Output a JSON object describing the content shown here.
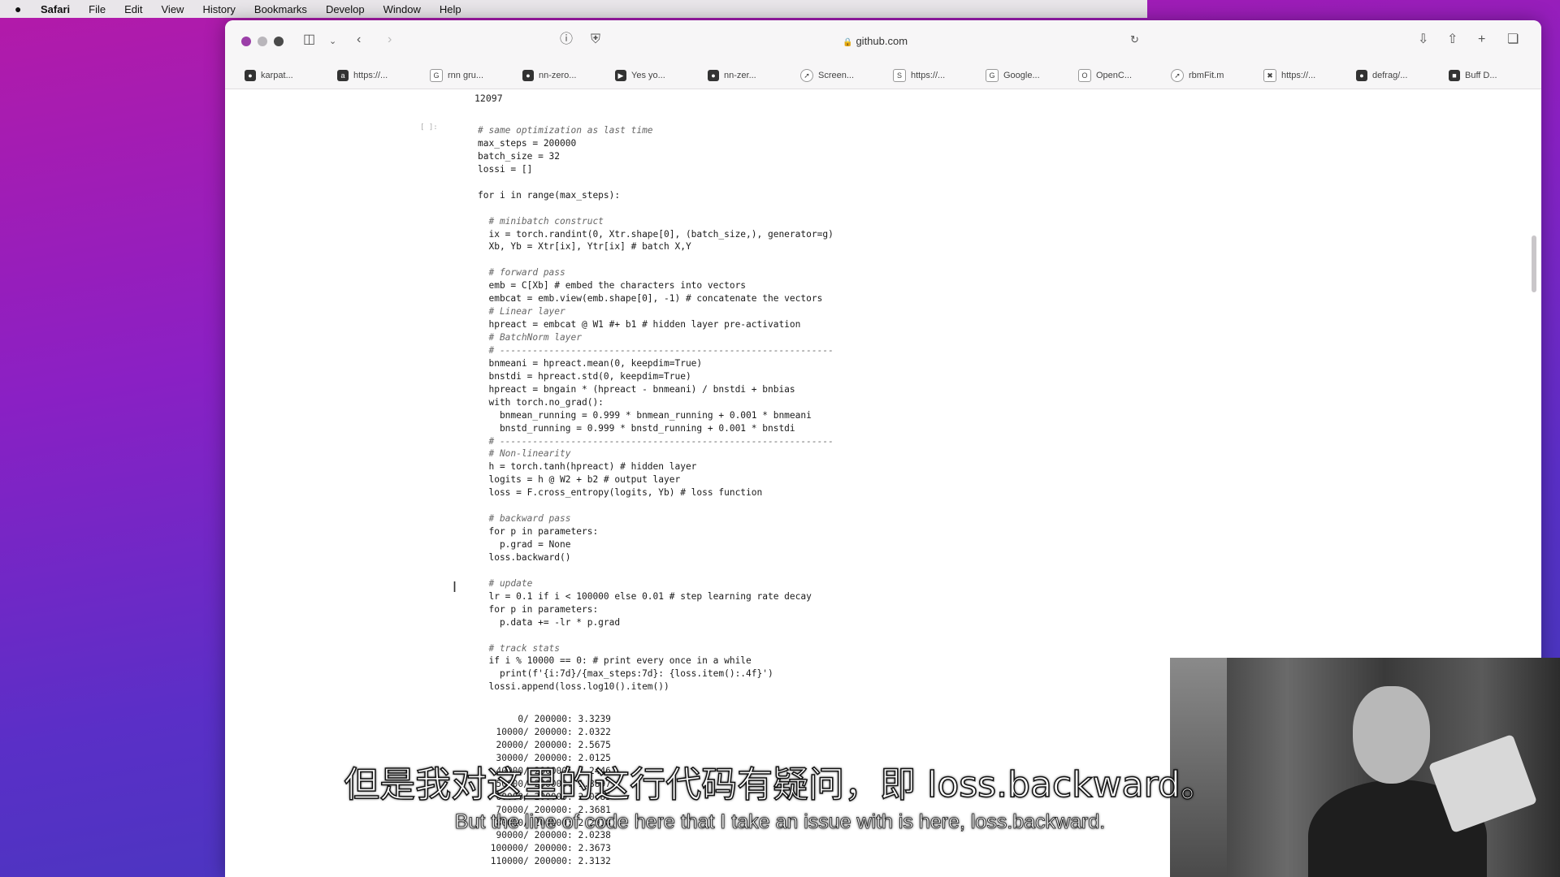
{
  "menubar": {
    "items": [
      "Safari",
      "File",
      "Edit",
      "View",
      "History",
      "Bookmarks",
      "Develop",
      "Window",
      "Help"
    ]
  },
  "browser": {
    "address": "github.com",
    "favorites": [
      {
        "label": "karpat...",
        "icon": "github-icon"
      },
      {
        "label": "https://...",
        "icon": "paper-icon"
      },
      {
        "label": "rnn gru...",
        "icon": "google-icon"
      },
      {
        "label": "nn-zero...",
        "icon": "github-icon"
      },
      {
        "label": "Yes yo...",
        "icon": "video-icon"
      },
      {
        "label": "nn-zer...",
        "icon": "github-icon"
      },
      {
        "label": "Screen...",
        "icon": "compass-icon"
      },
      {
        "label": "https://...",
        "icon": "page-icon"
      },
      {
        "label": "Google...",
        "icon": "page-icon"
      },
      {
        "label": "OpenC...",
        "icon": "page-icon"
      },
      {
        "label": "rbmFit.m",
        "icon": "compass-icon"
      },
      {
        "label": "https://...",
        "icon": "network-icon"
      },
      {
        "label": "defrag/...",
        "icon": "github-icon"
      },
      {
        "label": "Buff D...",
        "icon": "page-icon"
      }
    ]
  },
  "notebook": {
    "prev_output": "12097",
    "prompt": "[ ]:",
    "code_lines": [
      {
        "t": "# same optimization as last time",
        "c": true
      },
      {
        "t": "max_steps = 200000",
        "c": false
      },
      {
        "t": "batch_size = 32",
        "c": false
      },
      {
        "t": "lossi = []",
        "c": false
      },
      {
        "t": "",
        "c": false
      },
      {
        "t": "for i in range(max_steps):",
        "c": false
      },
      {
        "t": "",
        "c": false
      },
      {
        "t": "  # minibatch construct",
        "c": true
      },
      {
        "t": "  ix = torch.randint(0, Xtr.shape[0], (batch_size,), generator=g)",
        "c": false
      },
      {
        "t": "  Xb, Yb = Xtr[ix], Ytr[ix] # batch X,Y",
        "c": false
      },
      {
        "t": "",
        "c": false
      },
      {
        "t": "  # forward pass",
        "c": true
      },
      {
        "t": "  emb = C[Xb] # embed the characters into vectors",
        "c": false
      },
      {
        "t": "  embcat = emb.view(emb.shape[0], -1) # concatenate the vectors",
        "c": false
      },
      {
        "t": "  # Linear layer",
        "c": true
      },
      {
        "t": "  hpreact = embcat @ W1 #+ b1 # hidden layer pre-activation",
        "c": false
      },
      {
        "t": "  # BatchNorm layer",
        "c": true
      },
      {
        "t": "  # -------------------------------------------------------------",
        "c": true
      },
      {
        "t": "  bnmeani = hpreact.mean(0, keepdim=True)",
        "c": false
      },
      {
        "t": "  bnstdi = hpreact.std(0, keepdim=True)",
        "c": false
      },
      {
        "t": "  hpreact = bngain * (hpreact - bnmeani) / bnstdi + bnbias",
        "c": false
      },
      {
        "t": "  with torch.no_grad():",
        "c": false
      },
      {
        "t": "    bnmean_running = 0.999 * bnmean_running + 0.001 * bnmeani",
        "c": false
      },
      {
        "t": "    bnstd_running = 0.999 * bnstd_running + 0.001 * bnstdi",
        "c": false
      },
      {
        "t": "  # -------------------------------------------------------------",
        "c": true
      },
      {
        "t": "  # Non-linearity",
        "c": true
      },
      {
        "t": "  h = torch.tanh(hpreact) # hidden layer",
        "c": false
      },
      {
        "t": "  logits = h @ W2 + b2 # output layer",
        "c": false
      },
      {
        "t": "  loss = F.cross_entropy(logits, Yb) # loss function",
        "c": false
      },
      {
        "t": "",
        "c": false
      },
      {
        "t": "  # backward pass",
        "c": true
      },
      {
        "t": "  for p in parameters:",
        "c": false
      },
      {
        "t": "    p.grad = None",
        "c": false
      },
      {
        "t": "  loss.backward()",
        "c": false
      },
      {
        "t": "",
        "c": false
      },
      {
        "t": "  # update",
        "c": true
      },
      {
        "t": "  lr = 0.1 if i < 100000 else 0.01 # step learning rate decay",
        "c": false
      },
      {
        "t": "  for p in parameters:",
        "c": false
      },
      {
        "t": "    p.data += -lr * p.grad",
        "c": false
      },
      {
        "t": "",
        "c": false
      },
      {
        "t": "  # track stats",
        "c": true
      },
      {
        "t": "  if i % 10000 == 0: # print every once in a while",
        "c": false
      },
      {
        "t": "    print(f'{i:7d}/{max_steps:7d}: {loss.item():.4f}')",
        "c": false
      },
      {
        "t": "  lossi.append(loss.log10().item())",
        "c": false
      }
    ],
    "output_lines": [
      "      0/ 200000: 3.3239",
      "  10000/ 200000: 2.0322",
      "  20000/ 200000: 2.5675",
      "  30000/ 200000: 2.0125",
      "  40000/ 200000: 2.2446",
      "  50000/ 200000: 1.8897",
      "  60000/ 200000: 2.0785",
      "  70000/ 200000: 2.3681",
      "  80000/ 200000: 2.2918",
      "  90000/ 200000: 2.0238",
      " 100000/ 200000: 2.3673",
      " 110000/ 200000: 2.3132"
    ]
  },
  "subtitles": {
    "zh": "但是我对这里的这行代码有疑问，即 loss.backward。",
    "en": "But the line of code here that I take an issue with is here, loss.backward."
  }
}
